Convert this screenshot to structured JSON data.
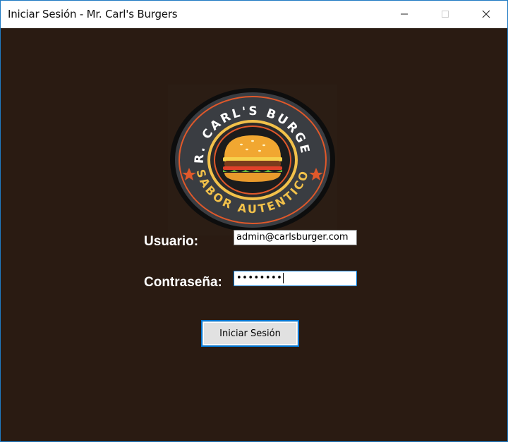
{
  "window": {
    "title": "Iniciar Sesión - Mr. Carl's  Burgers",
    "controls": [
      "minimize-icon",
      "maximize-icon",
      "close-icon"
    ]
  },
  "logo": {
    "top_text": "MR. CARL'S BURGERS",
    "bottom_text": "SABOR AUTENTICO",
    "icon": "burger-icon"
  },
  "form": {
    "usuario_label": "Usuario:",
    "usuario_value": "admin@carlsburger.com",
    "password_label": "Contraseña:",
    "password_masked": "••••••••",
    "submit_label": "Iniciar Sesión"
  },
  "colors": {
    "background": "#2a1b12",
    "accent_blue": "#0078d7",
    "logo_gold": "#f2c14a",
    "logo_orange": "#e0582a"
  }
}
